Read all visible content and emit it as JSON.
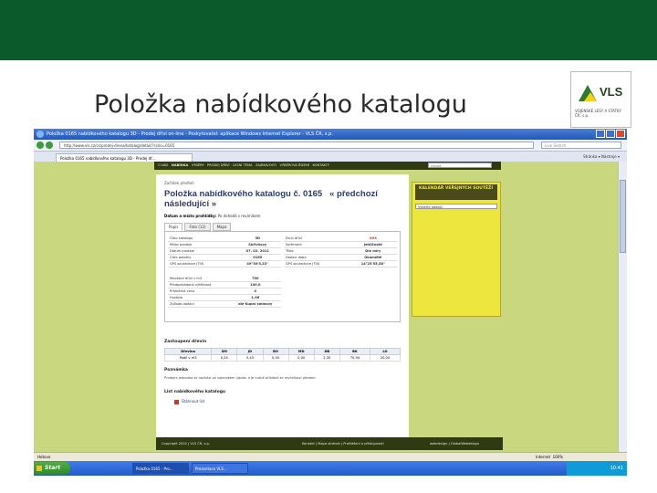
{
  "slide": {
    "title": "Položka nabídkového katalogu",
    "logo_text": "VLS",
    "logo_sub": "VOJENSKÉ LESY A STATKY ČR, s.p."
  },
  "browser": {
    "title": "Položka 0165 nabídkového katalogu 3D - Prodej dříví on-line - Poskytovatel: aplikace Windows Internet Explorer - VLS ČR, s.p.",
    "url": "http://www.vls.cz/cs/prodej-dreva/katalog/detail/?cislo=0165",
    "search_placeholder": "Live Search",
    "tab_label": "Položka 0165 nabídkového katalogu 3D - Prodej dř...",
    "tools": "Stránka ▾  Nástroje ▾"
  },
  "site": {
    "nav": [
      "O NÁS",
      "NABÍDKA",
      "VÝBĚRY",
      "PRODEJ DŘÍVÍ",
      "LESNÍ TÉMA",
      "ZAJÍMAVOSTI",
      "VÝBĚROVÁ ŘÍZENÍ",
      "KONTAKTY"
    ],
    "search_placeholder": "hledat"
  },
  "page": {
    "breadcrumb": "Začátek předloh",
    "heading": "Položka nabídkového katalogu č. 0165",
    "prev": "« předchozí",
    "next": "následující »",
    "meta_label": "Datum a místo prohlídky:",
    "meta_value": "Po dohodě s revírníkem",
    "tabs": [
      "Popis",
      "Foto (12)",
      "Mapa"
    ],
    "details_left": [
      [
        "Číslo katalogu",
        "3D"
      ],
      [
        "Místo prodeje",
        "Skřivňovy"
      ],
      [
        "Datum prodeje",
        "07. 02. 2011"
      ],
      [
        "Číslo položky",
        "0165"
      ],
      [
        "GPS souřadnice JTSK",
        "49°30'5,23\""
      ]
    ],
    "details_right": [
      [
        "Druh dříví",
        "VHS"
      ],
      [
        "Sortiment",
        "Jehličnaté"
      ],
      [
        "Třída",
        "Dle míry"
      ],
      [
        "Dodací doba",
        "Okamžitě"
      ],
      [
        "GPS souřadnice JTSK",
        "14°25'55,58\""
      ]
    ],
    "volumes": [
      [
        "Množství dříví v m3",
        "750"
      ],
      [
        "Předpokládaná výtěžnost",
        "100,0"
      ],
      [
        "Průměrná cena",
        "0"
      ],
      [
        "Hustota",
        "1,96"
      ],
      [
        "Způsob dodání",
        "dle Kupní smlouvy"
      ]
    ],
    "species_title": "Zastoupení dřevin",
    "species_headers": [
      "Dřevina",
      "SM",
      "JD",
      "BO",
      "MD",
      "DB",
      "BK",
      "LO"
    ],
    "species_row": [
      "Podíl v m3",
      "0,24",
      "5,43",
      "0,00",
      "0,00",
      "2,35",
      "70,94",
      "20,00"
    ],
    "note_title": "Poznámka",
    "note_text": "Prodejní jednotka se nachází ve vojenském újezdu a je nutné přihlásit se revírníkovi předem.",
    "list_title": "List nabídkového katalogu",
    "pdf_label": "Stáhnout list",
    "footer_left": "Copyright 2010 | VLS ČR, s.p.",
    "footer_mid": "Kontakt | Mapa stránek | Prohlášení o přístupnosti",
    "footer_right": "webdesign | GlobalWebdesign"
  },
  "sidebar": {
    "calendar_title": "KALENDÁŘ VEŘEJNÝCH SOUTĚŽÍ",
    "select_value": "Vyberte období"
  },
  "status": {
    "left": "Hotovo",
    "zone": "Internet",
    "zoom": "100%"
  },
  "taskbar": {
    "start": "Start",
    "tasks": [
      "Položka 0165 - Pro...",
      "Prezentace VLS..."
    ],
    "clock": "10:41"
  }
}
